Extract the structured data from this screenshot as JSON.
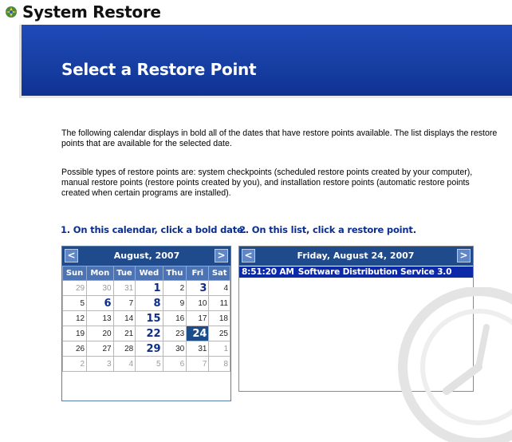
{
  "window": {
    "title": "System Restore"
  },
  "banner": {
    "title": "Select a Restore Point"
  },
  "intro": {
    "paragraph1": "The following calendar displays in bold all of the dates that have restore points available. The list displays the restore points that are available for the selected date.",
    "paragraph2": "Possible types of restore points are: system checkpoints (scheduled restore points created by your computer), manual restore points (restore points created by you), and installation restore points (automatic restore points created when certain programs are installed)."
  },
  "steps": {
    "step1": "1. On this calendar, click a bold date.",
    "step2": "2. On this list, click a restore point."
  },
  "calendar": {
    "month_label": "August, 2007",
    "prev_label": "<",
    "next_label": ">",
    "weekdays": [
      "Sun",
      "Mon",
      "Tue",
      "Wed",
      "Thu",
      "Fri",
      "Sat"
    ],
    "weeks": [
      [
        {
          "d": "29",
          "t": "other"
        },
        {
          "d": "30",
          "t": "other"
        },
        {
          "d": "31",
          "t": "other"
        },
        {
          "d": "1",
          "t": "bold"
        },
        {
          "d": "2",
          "t": ""
        },
        {
          "d": "3",
          "t": "bold"
        },
        {
          "d": "4",
          "t": ""
        }
      ],
      [
        {
          "d": "5",
          "t": ""
        },
        {
          "d": "6",
          "t": "bold"
        },
        {
          "d": "7",
          "t": ""
        },
        {
          "d": "8",
          "t": "bold"
        },
        {
          "d": "9",
          "t": ""
        },
        {
          "d": "10",
          "t": ""
        },
        {
          "d": "11",
          "t": ""
        }
      ],
      [
        {
          "d": "12",
          "t": ""
        },
        {
          "d": "13",
          "t": ""
        },
        {
          "d": "14",
          "t": ""
        },
        {
          "d": "15",
          "t": "bold"
        },
        {
          "d": "16",
          "t": ""
        },
        {
          "d": "17",
          "t": ""
        },
        {
          "d": "18",
          "t": ""
        }
      ],
      [
        {
          "d": "19",
          "t": ""
        },
        {
          "d": "20",
          "t": ""
        },
        {
          "d": "21",
          "t": ""
        },
        {
          "d": "22",
          "t": "bold"
        },
        {
          "d": "23",
          "t": ""
        },
        {
          "d": "24",
          "t": "sel"
        },
        {
          "d": "25",
          "t": ""
        }
      ],
      [
        {
          "d": "26",
          "t": ""
        },
        {
          "d": "27",
          "t": ""
        },
        {
          "d": "28",
          "t": ""
        },
        {
          "d": "29",
          "t": "bold"
        },
        {
          "d": "30",
          "t": ""
        },
        {
          "d": "31",
          "t": ""
        },
        {
          "d": "1",
          "t": "other"
        }
      ],
      [
        {
          "d": "2",
          "t": "other"
        },
        {
          "d": "3",
          "t": "other"
        },
        {
          "d": "4",
          "t": "other"
        },
        {
          "d": "5",
          "t": "other"
        },
        {
          "d": "6",
          "t": "other"
        },
        {
          "d": "7",
          "t": "other"
        },
        {
          "d": "8",
          "t": "other"
        }
      ]
    ]
  },
  "restore_list": {
    "date_label": "Friday, August 24, 2007",
    "prev_label": "<",
    "next_label": ">",
    "items": [
      {
        "time": "8:51:20 AM",
        "description": "Software Distribution Service 3.0"
      }
    ]
  },
  "colors": {
    "banner": "#173fa3",
    "header": "#1f4a8c",
    "selection": "#0c2aa8",
    "step_text": "#0c2e8c"
  },
  "icons": {
    "app": "system-restore-icon",
    "prev": "chevron-left-icon",
    "next": "chevron-right-icon"
  }
}
